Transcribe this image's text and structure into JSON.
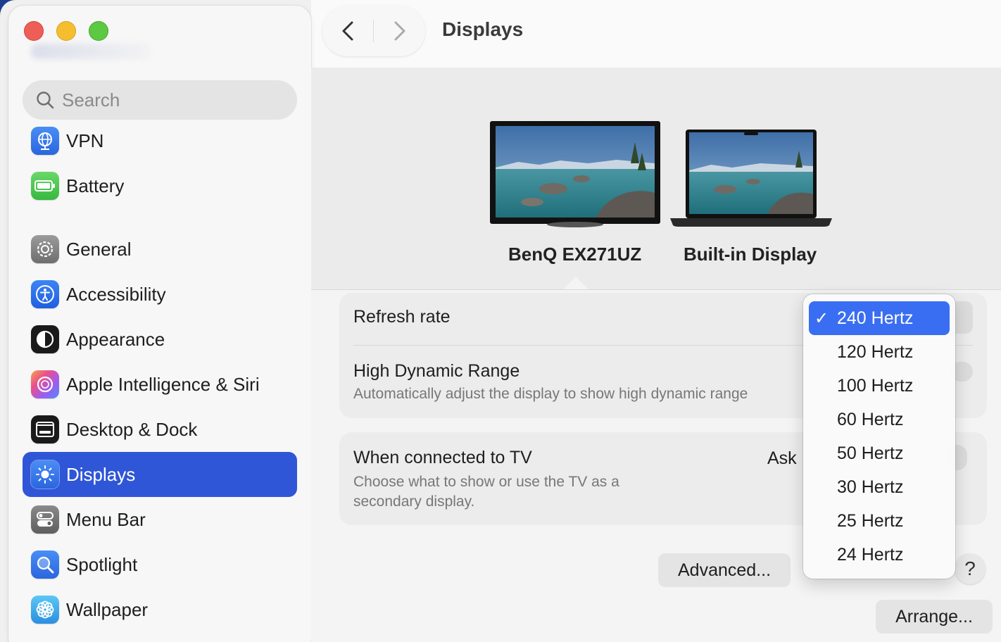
{
  "window": {
    "title": "Displays"
  },
  "sidebar": {
    "search_placeholder": "Search",
    "items": [
      {
        "label": "VPN",
        "icon": "vpn-globe-icon"
      },
      {
        "label": "Battery",
        "icon": "battery-icon"
      },
      {
        "label": "General",
        "icon": "gear-icon"
      },
      {
        "label": "Accessibility",
        "icon": "accessibility-icon"
      },
      {
        "label": "Appearance",
        "icon": "appearance-icon"
      },
      {
        "label": "Apple Intelligence & Siri",
        "icon": "siri-icon"
      },
      {
        "label": "Desktop & Dock",
        "icon": "dock-icon"
      },
      {
        "label": "Displays",
        "icon": "sun-icon",
        "selected": true
      },
      {
        "label": "Menu Bar",
        "icon": "menu-bar-icon"
      },
      {
        "label": "Spotlight",
        "icon": "magnifier-icon"
      },
      {
        "label": "Wallpaper",
        "icon": "flower-icon"
      }
    ]
  },
  "displays": [
    {
      "name": "BenQ EX271UZ",
      "selected": true
    },
    {
      "name": "Built-in Display",
      "selected": false
    }
  ],
  "settings": {
    "refresh_rate": {
      "label": "Refresh rate"
    },
    "hdr": {
      "label": "High Dynamic Range",
      "description": "Automatically adjust the display to show high dynamic range"
    },
    "tv": {
      "label": "When connected to TV",
      "value": "Ask",
      "description_line1": "Choose what to show or use the TV as a",
      "description_line2": "secondary display."
    }
  },
  "buttons": {
    "advanced": "Advanced...",
    "arrange": "Arrange...",
    "help": "?"
  },
  "refresh_menu": {
    "options": [
      "240 Hertz",
      "120 Hertz",
      "100 Hertz",
      "60 Hertz",
      "50 Hertz",
      "30 Hertz",
      "25 Hertz",
      "24 Hertz"
    ],
    "selected": "240 Hertz",
    "check": "✓"
  },
  "colors": {
    "accent": "#2f56d6",
    "menu_highlight": "#3a6ef2"
  }
}
